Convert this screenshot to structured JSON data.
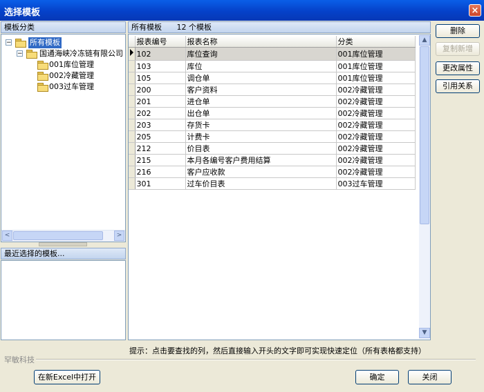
{
  "window": {
    "title": "选择模板",
    "close": "×"
  },
  "left": {
    "header": "模板分类",
    "tree": {
      "root": {
        "label": "所有模板",
        "expander": "−"
      },
      "company": {
        "label": "国通海峡冷冻链有限公司",
        "expander": "−"
      },
      "children": [
        "001库位管理",
        "002冷藏管理",
        "003过车管理"
      ]
    },
    "recent_header": "最近选择的模板..."
  },
  "right": {
    "header_label": "所有模板",
    "header_count": "12 个模板",
    "columns": [
      "报表编号",
      "报表名称",
      "分类"
    ],
    "rows": [
      [
        "102",
        "库位查询",
        "001库位管理"
      ],
      [
        "103",
        "库位",
        "001库位管理"
      ],
      [
        "105",
        "调仓单",
        "001库位管理"
      ],
      [
        "200",
        "客户资料",
        "002冷藏管理"
      ],
      [
        "201",
        "进仓单",
        "002冷藏管理"
      ],
      [
        "202",
        "出仓单",
        "002冷藏管理"
      ],
      [
        "203",
        "存货卡",
        "002冷藏管理"
      ],
      [
        "205",
        "计费卡",
        "002冷藏管理"
      ],
      [
        "212",
        "价目表",
        "002冷藏管理"
      ],
      [
        "215",
        "本月各编号客户费用结算",
        "002冷藏管理"
      ],
      [
        "216",
        "客户应收款",
        "002冷藏管理"
      ],
      [
        "301",
        "过车价目表",
        "003过车管理"
      ]
    ],
    "current_row": 0
  },
  "side_buttons": {
    "delete": "删除",
    "copy_add": "复制新增",
    "change_props": "更改属性",
    "references": "引用关系"
  },
  "hint": "提示：点击要查找的列，然后直接输入开头的文字即可实现快速定位（所有表格都支持）",
  "brand": "罕敏科技",
  "bottom_buttons": {
    "open_excel": "在新Excel中打开",
    "ok": "确定",
    "close": "关闭"
  },
  "scroll_arrows": {
    "left": "<",
    "right": ">",
    "up": "▲",
    "down": "▼"
  },
  "colors": {
    "title_bar": "#0541c9",
    "selection": "#316ac5",
    "window_bg": "#ece9d8"
  }
}
